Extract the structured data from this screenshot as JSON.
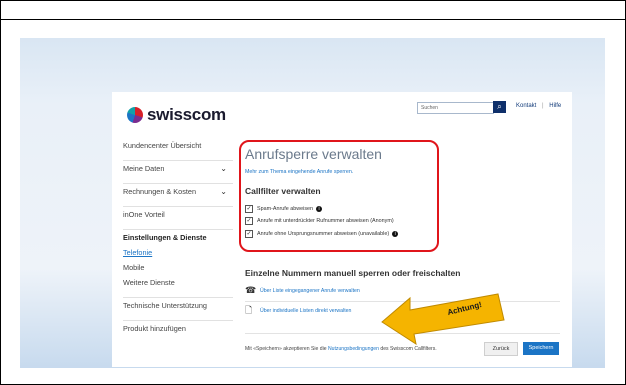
{
  "header": {
    "logo_text": "swisscom",
    "search_placeholder": "Suchen",
    "links": [
      "Kontakt",
      "|",
      "Hilfe"
    ]
  },
  "sidebar": {
    "items": [
      {
        "label": "Kundencenter Übersicht"
      },
      {
        "label": "Meine Daten",
        "chevron": "v"
      },
      {
        "label": "Rechnungen & Kosten",
        "chevron": "v"
      },
      {
        "label": "inOne Vorteil"
      },
      {
        "label": "Einstellungen & Dienste"
      },
      {
        "label": "Telefonie"
      },
      {
        "label": "Mobile"
      },
      {
        "label": "Weitere Dienste"
      },
      {
        "label": "Technische Unterstützung"
      },
      {
        "label": "Produkt hinzufügen"
      }
    ]
  },
  "main": {
    "title": "Anrufsperre verwalten",
    "subtitle": "Mehr zum Thema eingehende Anrufe sperren.",
    "callfilter_heading": "Callfilter verwalten",
    "checkboxes": [
      {
        "label": "Spam-Anrufe abweisen",
        "checked": true,
        "info": true
      },
      {
        "label": "Anrufe mit unterdrückter Rufnummer abweisen (Anonym)",
        "checked": true,
        "info": false
      },
      {
        "label": "Anrufe ohne Ursprungsnummer abweisen (unavailable)",
        "checked": true,
        "info": true
      }
    ],
    "section2_heading": "Einzelne Nummern manuell sperren oder freischalten",
    "links": [
      {
        "label": "Über Liste eingegangener Anrufe verwalten",
        "icon": "phone-icon"
      },
      {
        "label": "Über individuelle Listen direkt verwalten",
        "icon": "document-icon"
      }
    ],
    "annotation": "Achtung!",
    "footer_before": "Mit «Speichern» akzeptieren Sie die ",
    "footer_link": "Nutzungsbedingungen",
    "footer_after": " des Swisscom Callfilters.",
    "back_label": "Zurück",
    "save_label": "Speichern"
  },
  "colors": {
    "accent": "#1b74c5",
    "highlight": "#e0151b",
    "arrow": "#f5b400"
  }
}
